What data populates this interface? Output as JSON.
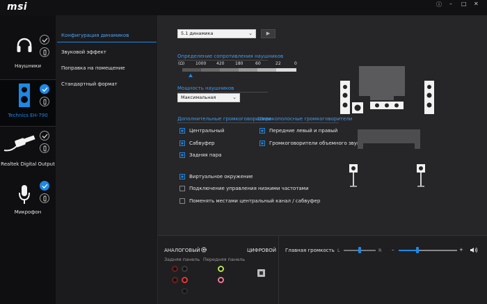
{
  "app": {
    "logo": "msi",
    "window_controls": {
      "info": "ⓘ",
      "minimize": "–",
      "restore": "□",
      "close": "✕"
    }
  },
  "devices": [
    {
      "label": "Наушники",
      "icon": "headphones-icon",
      "active": false,
      "checked": false
    },
    {
      "label": "Technics EH-790",
      "icon": "speaker-icon",
      "active": true,
      "checked": true
    },
    {
      "label": "Realtek Digital Output",
      "icon": "optical-cable-icon",
      "active": false,
      "checked": false
    },
    {
      "label": "Микрофон",
      "icon": "microphone-icon",
      "active": false,
      "checked": true
    }
  ],
  "nav": {
    "items": [
      {
        "label": "Конфигурация динамиков",
        "active": true
      },
      {
        "label": "Звуковой эффект",
        "active": false
      },
      {
        "label": "Поправка на помещение",
        "active": false
      },
      {
        "label": "Стандартный формат",
        "active": false
      }
    ]
  },
  "config": {
    "speaker_select": "5.1 динамика",
    "impedance_title": "Определение сопротивления наушников",
    "impedance_unit": "(Ω)",
    "impedance_ticks": [
      "1000",
      "420",
      "180",
      "60",
      "22",
      "0"
    ],
    "power_title": "Мощность наушников",
    "power_select": "Максимальная",
    "extra_title": "Дополнительные громкоговорители",
    "fullrange_title": "Широкополосные громкоговорители",
    "extra_options": [
      {
        "label": "Центральный",
        "checked": true
      },
      {
        "label": "Сабвуфер",
        "checked": true
      },
      {
        "label": "Задняя пара",
        "checked": true
      }
    ],
    "fullrange_options": [
      {
        "label": "Передние левый и правый",
        "checked": true
      },
      {
        "label": "Громкоговорители объемного звука",
        "checked": true
      }
    ],
    "bottom_options": [
      {
        "label": "Виртуальное окружение",
        "checked": true
      },
      {
        "label": "Подключение управления низкими частотами",
        "checked": false
      },
      {
        "label": "Поменять местами центральный канал / сабвуфер",
        "checked": false
      }
    ]
  },
  "connectors": {
    "analog_label": "АНАЛОГОВЫЙ",
    "digital_label": "ЦИФРОВОЙ",
    "rear_panel": "Задняя панель",
    "front_panel": "Передняя панель"
  },
  "volume": {
    "title": "Главная громкость",
    "balance_left": "L",
    "balance_right": "R",
    "minus": "–",
    "plus": "+",
    "balance_value": 0.5,
    "volume_value": 0.38
  },
  "colors": {
    "accent": "#1e88e5",
    "jack_green": "#b9e34b",
    "jack_pink": "#f07a9a",
    "jack_red": "#e53935"
  }
}
